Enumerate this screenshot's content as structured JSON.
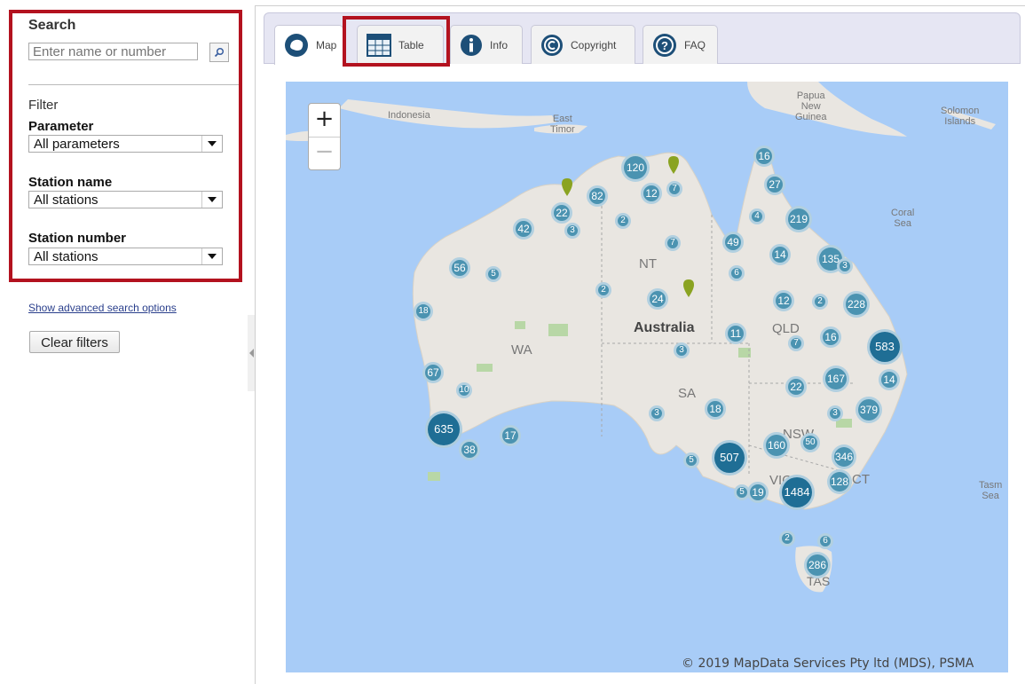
{
  "sidebar": {
    "search_title": "Search",
    "search_placeholder": "Enter name or number",
    "filter_heading": "Filter",
    "parameter_label": "Parameter",
    "parameter_value": "All parameters",
    "station_name_label": "Station name",
    "station_name_value": "All stations",
    "station_number_label": "Station number",
    "station_number_value": "All stations",
    "advanced_link": "Show advanced search options",
    "clear_filters": "Clear filters"
  },
  "tabs": [
    {
      "label": "Map",
      "icon": "map-icon"
    },
    {
      "label": "Table",
      "icon": "table-icon"
    },
    {
      "label": "Info",
      "icon": "info-icon"
    },
    {
      "label": "Copyright",
      "icon": "copyright-icon"
    },
    {
      "label": "FAQ",
      "icon": "faq-icon"
    }
  ],
  "map": {
    "zoom_in": "+",
    "zoom_out": "−",
    "copyright": "© 2019 MapData Services Pty ltd (MDS), PSMA",
    "labels": {
      "indonesia": "Indonesia",
      "east_timor": "East\nTimor",
      "papua_new_guinea": "Papua\nNew\nGuinea",
      "solomon_islands": "Solomon\nIslands",
      "coral_sea": "Coral\nSea",
      "tasman_sea": "Tasm\nSea",
      "australia": "Australia",
      "wa": "WA",
      "nt": "NT",
      "sa": "SA",
      "qld": "QLD",
      "nsw": "NSW",
      "vic": "VIC",
      "act": "ACT",
      "tas": "TAS"
    },
    "clusters": [
      "120",
      "12",
      "7",
      "82",
      "22",
      "3",
      "2",
      "42",
      "56",
      "5",
      "18",
      "67",
      "10",
      "635",
      "38",
      "17",
      "7",
      "2",
      "24",
      "49",
      "6",
      "16",
      "27",
      "4",
      "219",
      "14",
      "135",
      "3",
      "12",
      "2",
      "228",
      "11",
      "7",
      "16",
      "583",
      "3",
      "167",
      "14",
      "22",
      "379",
      "3",
      "18",
      "3",
      "160",
      "50",
      "346",
      "507",
      "5",
      "5",
      "19",
      "1484",
      "128",
      "2",
      "6",
      "286"
    ]
  },
  "colors": {
    "highlight": "#b3121f",
    "cluster": "#4b93b1",
    "cluster_big": "#1f6e95",
    "sea": "#a8ccf7",
    "land": "#e9e6e1"
  }
}
